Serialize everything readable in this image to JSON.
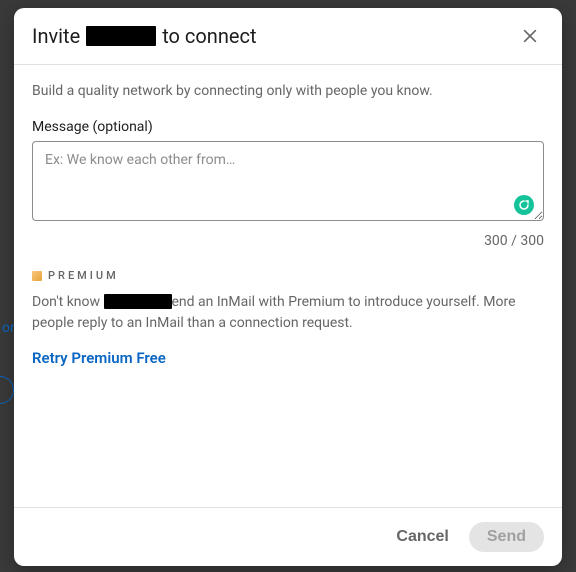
{
  "modal": {
    "title_prefix": "Invite",
    "title_suffix": "to connect",
    "subtitle": "Build a quality network by connecting only with people you know.",
    "message_label": "Message (optional)",
    "textarea_placeholder": "Ex: We know each other from…",
    "char_count": "300 / 300"
  },
  "premium": {
    "badge": "PREMIUM",
    "desc_prefix": "Don't know ",
    "desc_suffix": "end an InMail with Premium to introduce yourself. More people reply to an InMail than a connection request.",
    "retry_link": "Retry Premium Free"
  },
  "footer": {
    "cancel_label": "Cancel",
    "send_label": "Send"
  },
  "bg": {
    "left_text": "on"
  }
}
